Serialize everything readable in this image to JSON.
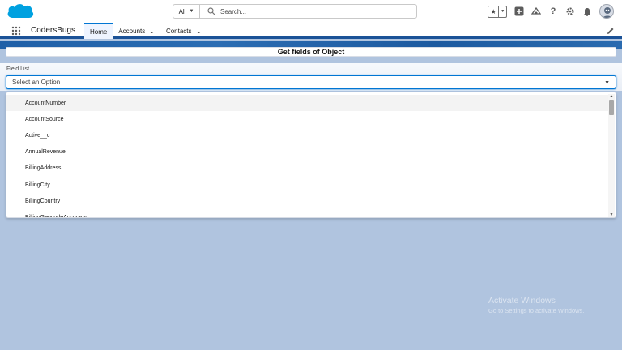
{
  "header": {
    "search_scope": "All",
    "search_placeholder": "Search..."
  },
  "nav": {
    "app_name": "CodersBugs",
    "tabs": [
      {
        "label": "Home",
        "active": true
      },
      {
        "label": "Accounts",
        "active": false
      },
      {
        "label": "Contacts",
        "active": false
      }
    ]
  },
  "card": {
    "title": "Get fields of Object"
  },
  "field": {
    "label": "Field List",
    "placeholder": "Select an Option"
  },
  "options": [
    "AccountNumber",
    "AccountSource",
    "Active__c",
    "AnnualRevenue",
    "BillingAddress",
    "BillingCity",
    "BillingCountry",
    "BillingGeocodeAccuracy"
  ],
  "watermark": {
    "title": "Activate Windows",
    "subtitle": "Go to Settings to activate Windows."
  },
  "colors": {
    "brand": "#0176d3",
    "nav_border": "#1b5297",
    "background": "#b0c4df"
  }
}
